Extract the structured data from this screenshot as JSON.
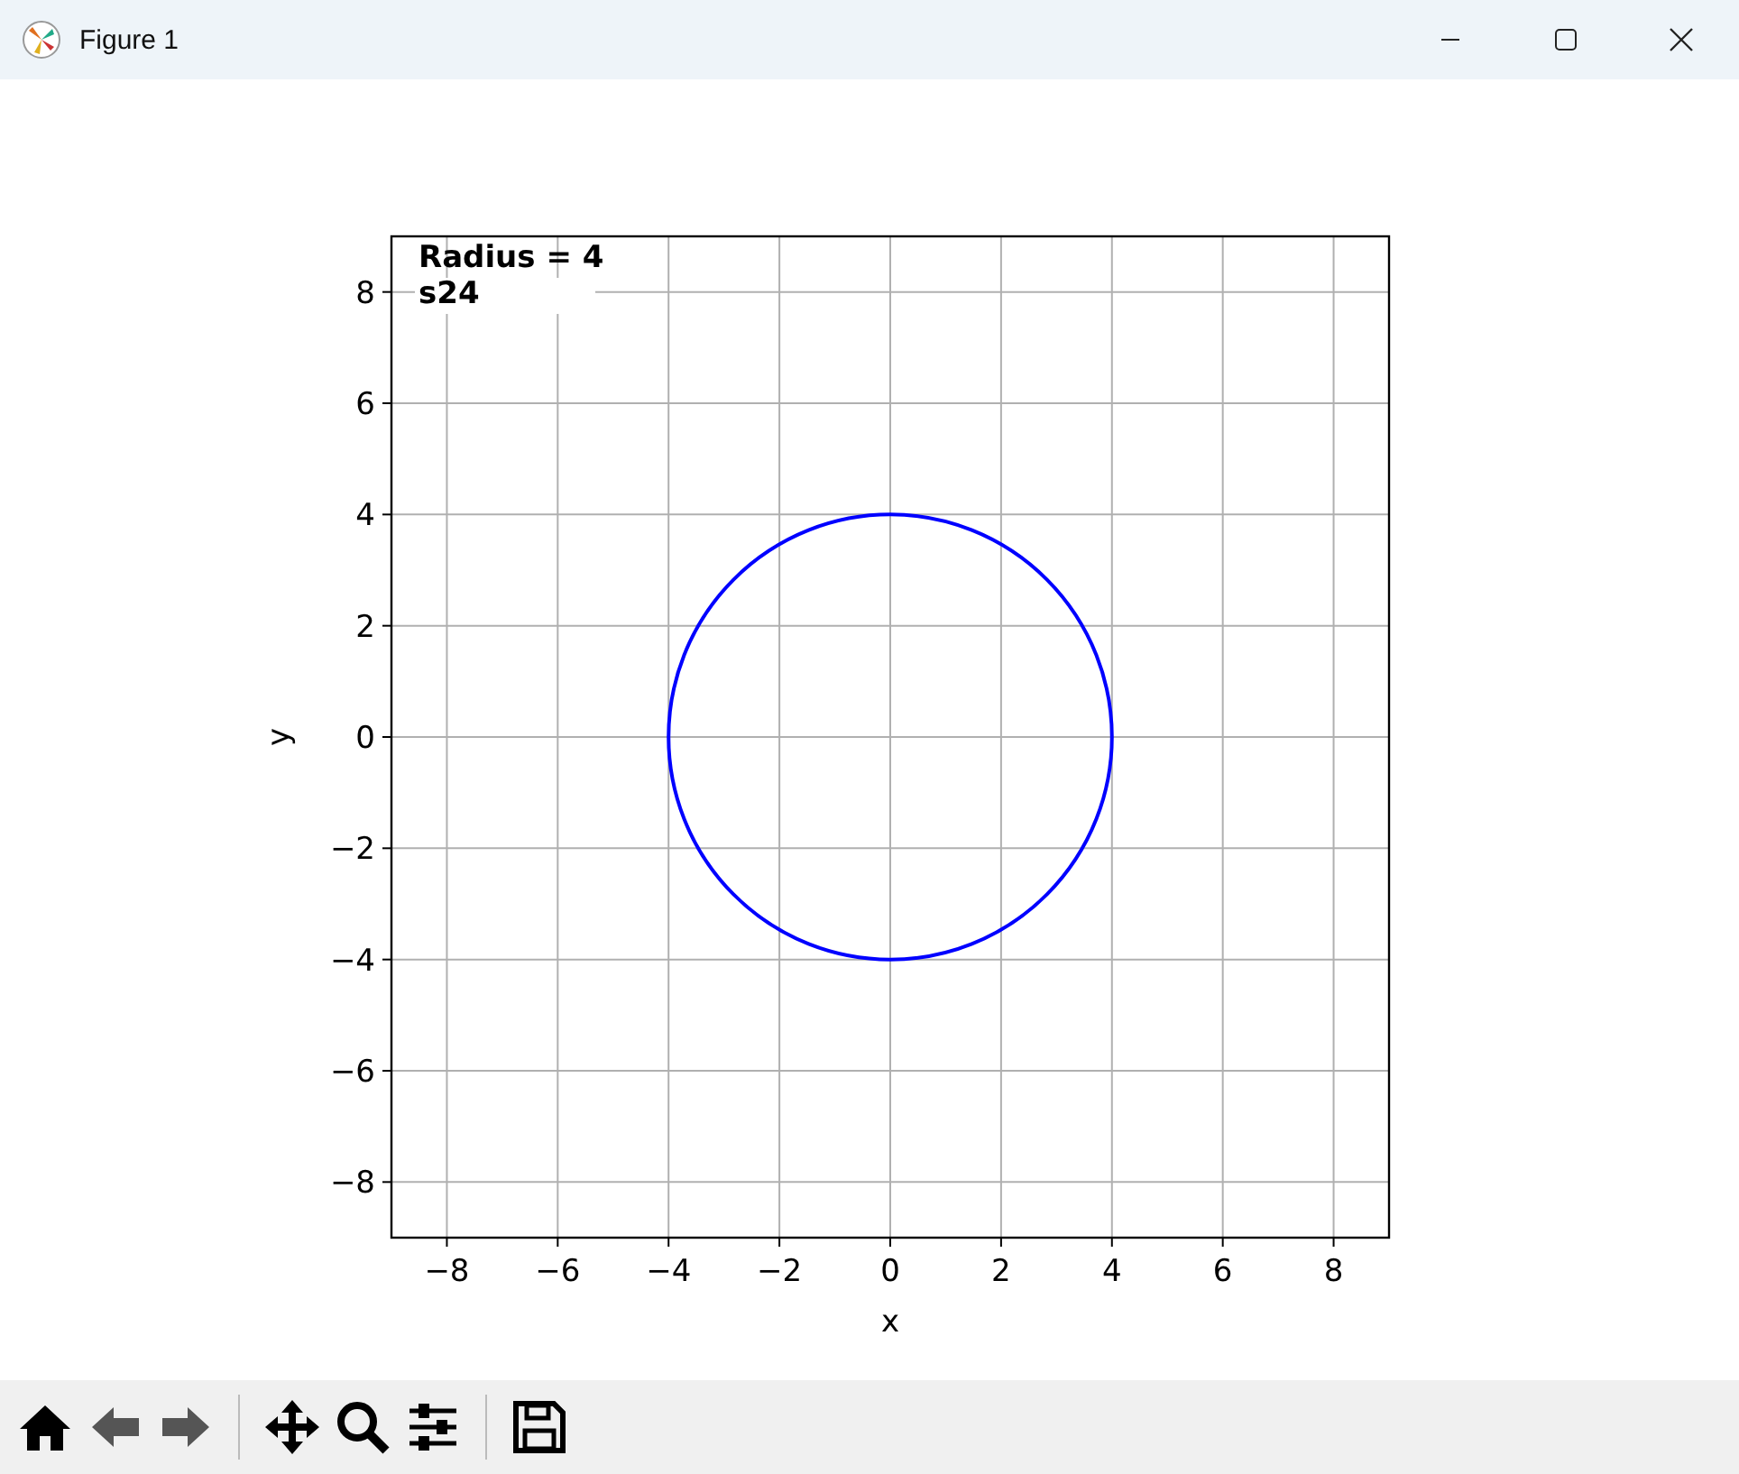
{
  "window": {
    "title": "Figure 1"
  },
  "figure": {
    "chart_data": {
      "type": "line",
      "xlabel": "x",
      "ylabel": "y",
      "xlim": [
        -9,
        9
      ],
      "ylim": [
        -9,
        9
      ],
      "grid": true,
      "xticks": [
        {
          "value": -8,
          "label": "−8"
        },
        {
          "value": -6,
          "label": "−6"
        },
        {
          "value": -4,
          "label": "−4"
        },
        {
          "value": -2,
          "label": "−2"
        },
        {
          "value": 0,
          "label": "0"
        },
        {
          "value": 2,
          "label": "2"
        },
        {
          "value": 4,
          "label": "4"
        },
        {
          "value": 6,
          "label": "6"
        },
        {
          "value": 8,
          "label": "8"
        }
      ],
      "yticks": [
        {
          "value": -8,
          "label": "−8"
        },
        {
          "value": -6,
          "label": "−6"
        },
        {
          "value": -4,
          "label": "−4"
        },
        {
          "value": -2,
          "label": "−2"
        },
        {
          "value": 0,
          "label": "0"
        },
        {
          "value": 2,
          "label": "2"
        },
        {
          "value": 4,
          "label": "4"
        },
        {
          "value": 6,
          "label": "6"
        },
        {
          "value": 8,
          "label": "8"
        }
      ],
      "annotations": [
        "Radius = 4",
        "s24"
      ]
    }
  },
  "toolbar": [
    {
      "kind": "home"
    },
    {
      "kind": "back"
    },
    {
      "kind": "forward"
    },
    {
      "kind": "separator"
    },
    {
      "kind": "pan"
    },
    {
      "kind": "zoom"
    },
    {
      "kind": "configure"
    },
    {
      "kind": "separator"
    },
    {
      "kind": "save"
    }
  ]
}
